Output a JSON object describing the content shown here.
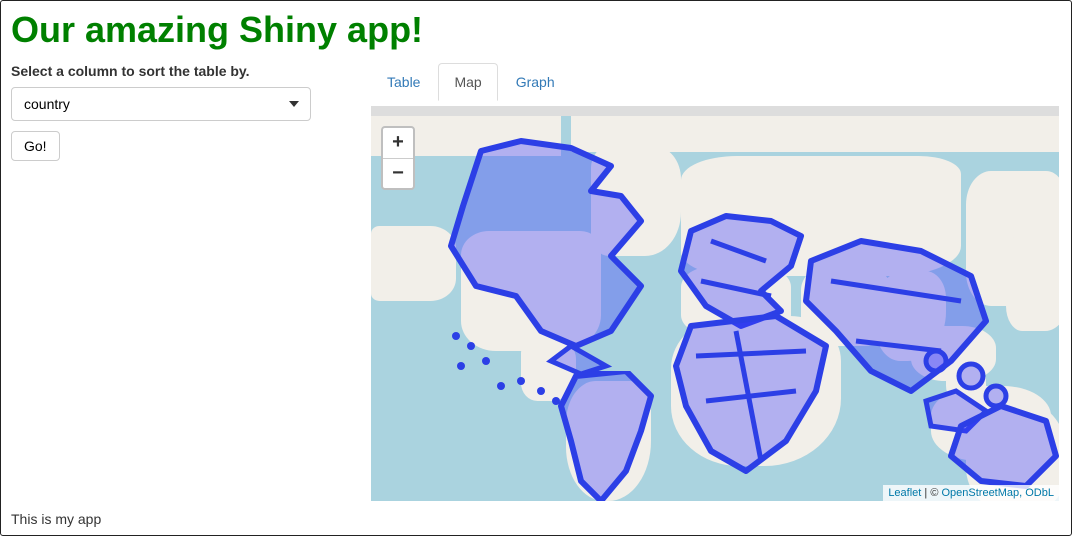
{
  "title": "Our amazing Shiny app!",
  "sidebar": {
    "label": "Select a column to sort the table by.",
    "select_value": "country",
    "go_label": "Go!"
  },
  "tabs": [
    {
      "label": "Table",
      "active": false
    },
    {
      "label": "Map",
      "active": true
    },
    {
      "label": "Graph",
      "active": false
    }
  ],
  "map": {
    "zoom_in": "+",
    "zoom_out": "−",
    "attribution_prefix": "Leaflet",
    "attribution_sep": " | © ",
    "attribution_link": "OpenStreetMap, ODbL"
  },
  "footer": "This is my app"
}
